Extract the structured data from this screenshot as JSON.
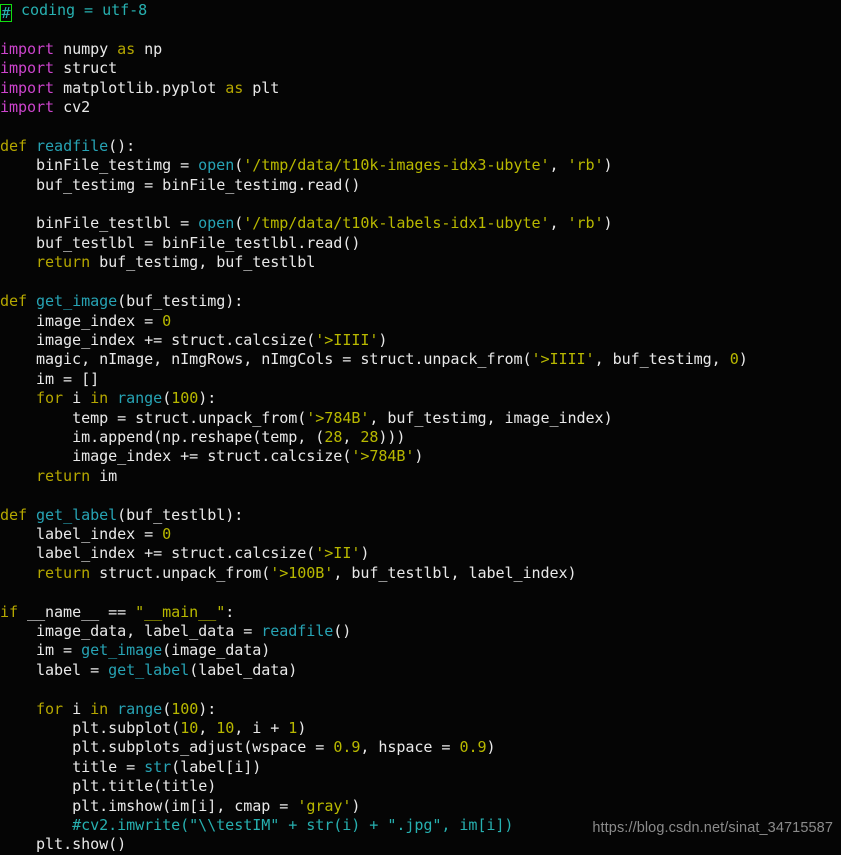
{
  "editor": {
    "background_color": "#050505",
    "default_text_color": "#e9e9e9",
    "language": "python",
    "font_size_px": 15,
    "line_height_px": 19.4
  },
  "palette": {
    "keyword": "#b5a700",
    "import": "#cc44cc",
    "function": "#27a3b4",
    "string": "#b8b800",
    "number": "#b8b800",
    "comment": "#27b0b0",
    "identifier": "#e9e9e9",
    "match_box_border": "#11dd11",
    "watermark": "#8b8b8b"
  },
  "code": {
    "lines": [
      "# coding = utf-8",
      "",
      "import numpy as np",
      "import struct",
      "import matplotlib.pyplot as plt",
      "import cv2",
      "",
      "def readfile():",
      "    binFile_testimg = open('/tmp/data/t10k-images-idx3-ubyte', 'rb')",
      "    buf_testimg = binFile_testimg.read()",
      "",
      "    binFile_testlbl = open('/tmp/data/t10k-labels-idx1-ubyte', 'rb')",
      "    buf_testlbl = binFile_testlbl.read()",
      "    return buf_testimg, buf_testlbl",
      "",
      "def get_image(buf_testimg):",
      "    image_index = 0",
      "    image_index += struct.calcsize('>IIII')",
      "    magic, nImage, nImgRows, nImgCols = struct.unpack_from('>IIII', buf_testimg, 0)",
      "    im = []",
      "    for i in range(100):",
      "        temp = struct.unpack_from('>784B', buf_testimg, image_index)",
      "        im.append(np.reshape(temp, (28, 28)))",
      "        image_index += struct.calcsize('>784B')",
      "    return im",
      "",
      "def get_label(buf_testlbl):",
      "    label_index = 0",
      "    label_index += struct.calcsize('>II')",
      "    return struct.unpack_from('>100B', buf_testlbl, label_index)",
      "",
      "if __name__ == \"__main__\":",
      "    image_data, label_data = readfile()",
      "    im = get_image(image_data)",
      "    label = get_label(label_data)",
      "",
      "    for i in range(100):",
      "        plt.subplot(10, 10, i + 1)",
      "        plt.subplots_adjust(wspace = 0.9, hspace = 0.9)",
      "        title = str(label[i])",
      "        plt.title(title)",
      "        plt.imshow(im[i], cmap = 'gray')",
      "        #cv2.imwrite(\"\\\\testIM\" + str(i) + \".jpg\", im[i])",
      "    plt.show()"
    ],
    "line_count": 43
  },
  "highlight": {
    "match_box_char": "#",
    "match_box_line": 1,
    "match_box_column": 1
  },
  "watermark": {
    "text": "https://blog.csdn.net/sinat_34715587"
  }
}
